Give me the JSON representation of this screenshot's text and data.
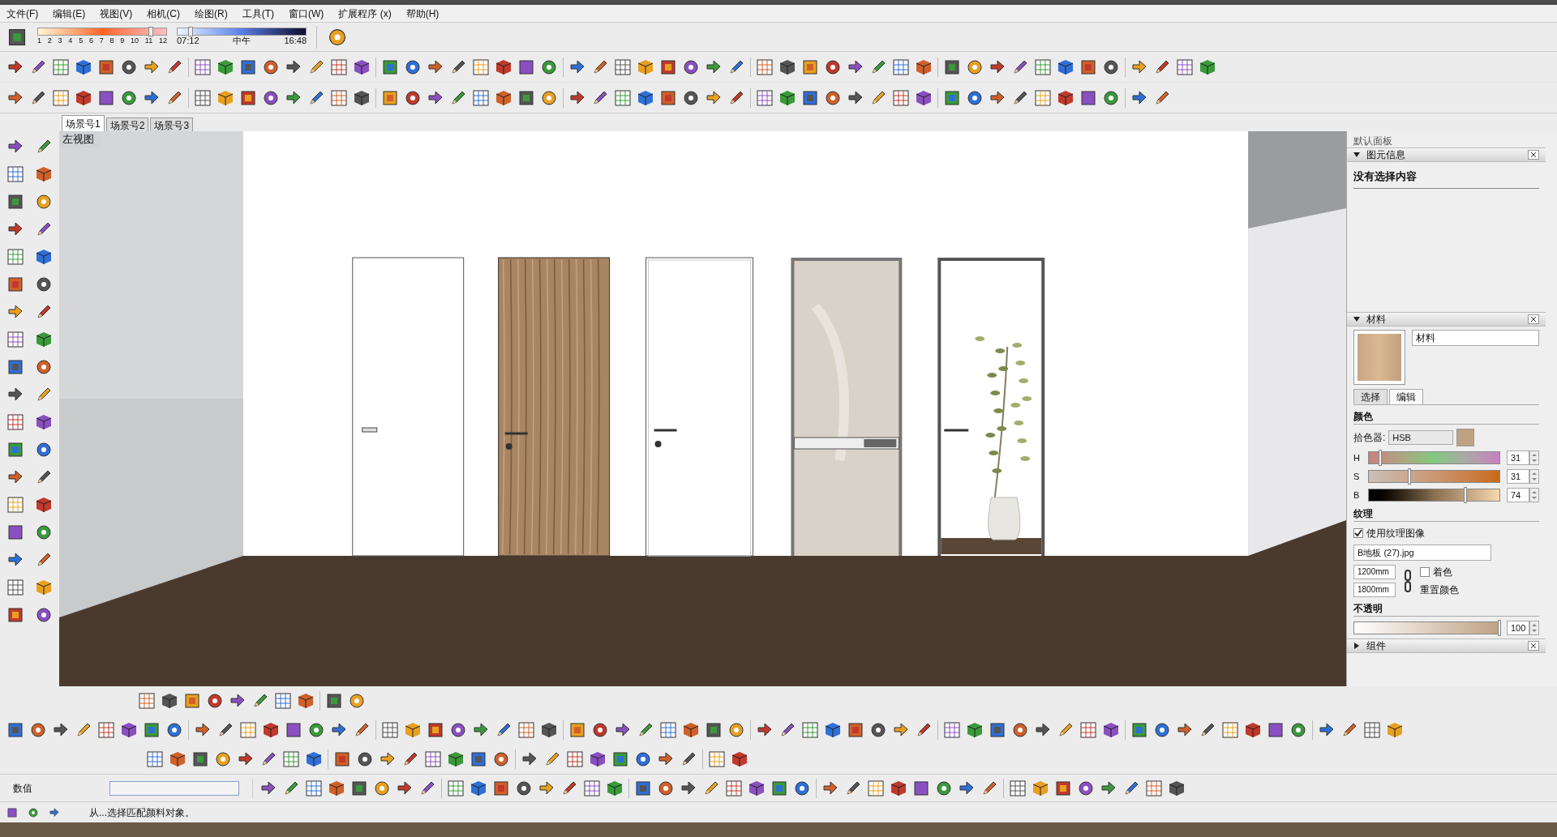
{
  "menu": [
    {
      "label": "文件(F)"
    },
    {
      "label": "编辑(E)"
    },
    {
      "label": "视图(V)"
    },
    {
      "label": "相机(C)"
    },
    {
      "label": "绘图(R)"
    },
    {
      "label": "工具(T)"
    },
    {
      "label": "窗口(W)"
    },
    {
      "label": "扩展程序 (x)"
    },
    {
      "label": "帮助(H)"
    }
  ],
  "shadow_toolbar": {
    "months": [
      "1",
      "2",
      "3",
      "4",
      "5",
      "6",
      "7",
      "8",
      "9",
      "10",
      "11",
      "12"
    ],
    "month_slider": {
      "level": 0.86
    },
    "time_start": "07:12",
    "time_mid": "中午",
    "time_end": "16:48",
    "time_slider": {
      "level": 0.08
    }
  },
  "scene_tabs": [
    {
      "label": "场景号1",
      "selected": true
    },
    {
      "label": "场景号2",
      "selected": false
    },
    {
      "label": "场景号3",
      "selected": false
    }
  ],
  "viewport": {
    "view_label": "左视图"
  },
  "panel": {
    "title": "默认面板",
    "entity_info": {
      "title": "图元信息",
      "expanded": true,
      "text": "没有选择内容"
    },
    "materials": {
      "title": "材料",
      "expanded": true,
      "name": "材料",
      "tabs": [
        {
          "label": "选择",
          "selected": false
        },
        {
          "label": "编辑",
          "selected": true
        }
      ],
      "color_title": "颜色",
      "picker_label": "拾色器:",
      "picker": "HSB",
      "sliders": [
        {
          "label": "H",
          "level": 0.09,
          "value": "31"
        },
        {
          "label": "S",
          "level": 0.31,
          "value": "31"
        },
        {
          "label": "B",
          "level": 0.74,
          "value": "74"
        }
      ],
      "texture_title": "纹理",
      "use_texture": {
        "label": "使用纹理图像",
        "checked": true
      },
      "file": "B地板 (27).jpg",
      "width": "1200mm",
      "height": "1800mm",
      "colorize": {
        "label": "着色",
        "checked": false
      },
      "reset": "重置颜色",
      "opacity_title": "不透明",
      "opacity": {
        "level": 1,
        "value": "100"
      }
    },
    "components": {
      "title": "组件",
      "expanded": false
    }
  },
  "value_box": {
    "label": "数值"
  },
  "status": {
    "text": "从...选择匹配颜料对象。"
  }
}
